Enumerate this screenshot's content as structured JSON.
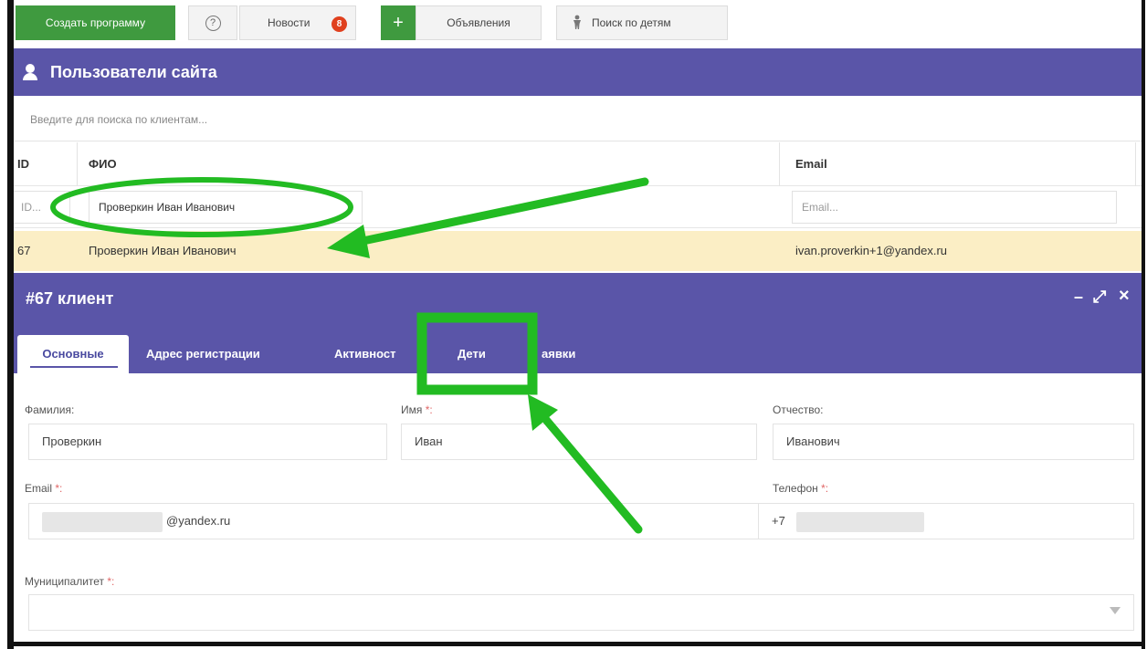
{
  "toolbar": {
    "create_label": "Создать программу",
    "help_label": "?",
    "news_label": "Новости",
    "news_badge": "8",
    "add_label": "+",
    "ads_label": "Объявления",
    "kids_label": "Поиск по детям"
  },
  "users": {
    "title": "Пользователи сайта",
    "search_placeholder": "Введите для поиска по клиентам...",
    "columns": {
      "id": "ID",
      "fio": "ФИО",
      "email": "Email"
    },
    "filters": {
      "id": "ID...",
      "fio": "Проверкин Иван Иванович",
      "email": "Email..."
    },
    "row": {
      "id": "67",
      "fio": "Проверкин Иван Иванович",
      "email": "ivan.proverkin+1@yandex.ru"
    }
  },
  "client": {
    "title": "#67 клиент",
    "controls": {
      "minimize": "–",
      "expand": "⤢",
      "close": "×"
    },
    "tabs": [
      "Основные",
      "Адрес регистрации",
      "Активност",
      "Дети",
      "аявки"
    ],
    "form": {
      "lastname_label": "Фамилия:",
      "lastname_value": "Проверкин",
      "firstname_label": "Имя",
      "firstname_value": "Иван",
      "patronymic_label": "Отчество:",
      "patronymic_value": "Иванович",
      "email_label": "Email",
      "email_value": "@yandex.ru",
      "phone_label": "Телефон",
      "phone_value": "+7",
      "municipality_label": "Муниципалитет",
      "required_mark": "*:"
    }
  },
  "colors": {
    "header_purple": "#5a55a8",
    "create_green": "#3f9a3f",
    "selected_row": "#fbeec5",
    "annotation_green": "#22bb22"
  }
}
